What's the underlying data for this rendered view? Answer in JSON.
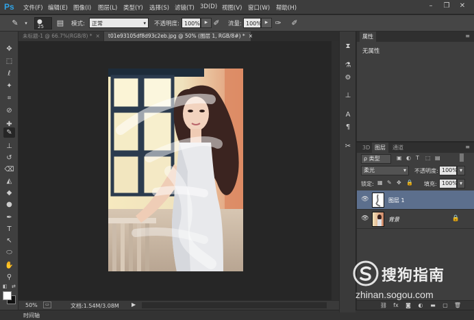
{
  "app": {
    "logo_text": "Ps"
  },
  "menu": [
    "文件(F)",
    "编辑(E)",
    "图像(I)",
    "图层(L)",
    "类型(Y)",
    "选择(S)",
    "滤镜(T)",
    "3D(D)",
    "视图(V)",
    "窗口(W)",
    "帮助(H)"
  ],
  "options": {
    "brush_size": "25",
    "mode_label": "模式:",
    "mode_value": "正常",
    "opacity_label": "不透明度:",
    "opacity_value": "100%",
    "flow_label": "流量:",
    "flow_value": "100%"
  },
  "tabs": [
    {
      "label": "未标题-1 @ 66.7%(RGB/8) *",
      "close": "×",
      "active": false
    },
    {
      "label": "t01e93105df8d93c2eb.jpg @ 50% (图层 1, RGB/8#) *",
      "close": "×",
      "active": true
    }
  ],
  "status": {
    "zoom": "50%",
    "doc_info": "文档:1.54M/3.08M",
    "timeline": "时间轴"
  },
  "properties": {
    "tab_label": "属性",
    "content": "无属性"
  },
  "layers_panel": {
    "tabs": [
      "3D",
      "图层",
      "通道"
    ],
    "active_tab": "图层",
    "filter_kind": "ρ 类型",
    "blend_mode": "柔光",
    "opacity_label": "不透明度:",
    "opacity_value": "100%",
    "lock_label": "锁定:",
    "fill_label": "填充:",
    "fill_value": "100%",
    "layers": [
      {
        "name": "图层 1",
        "selected": true
      },
      {
        "name": "背景",
        "selected": false
      }
    ]
  },
  "watermark": {
    "title": "搜狗指南",
    "url": "zhinan.sogou.com"
  },
  "colors": {
    "accent": "#2fa3e6",
    "selected_layer": "#5c6f8d"
  }
}
